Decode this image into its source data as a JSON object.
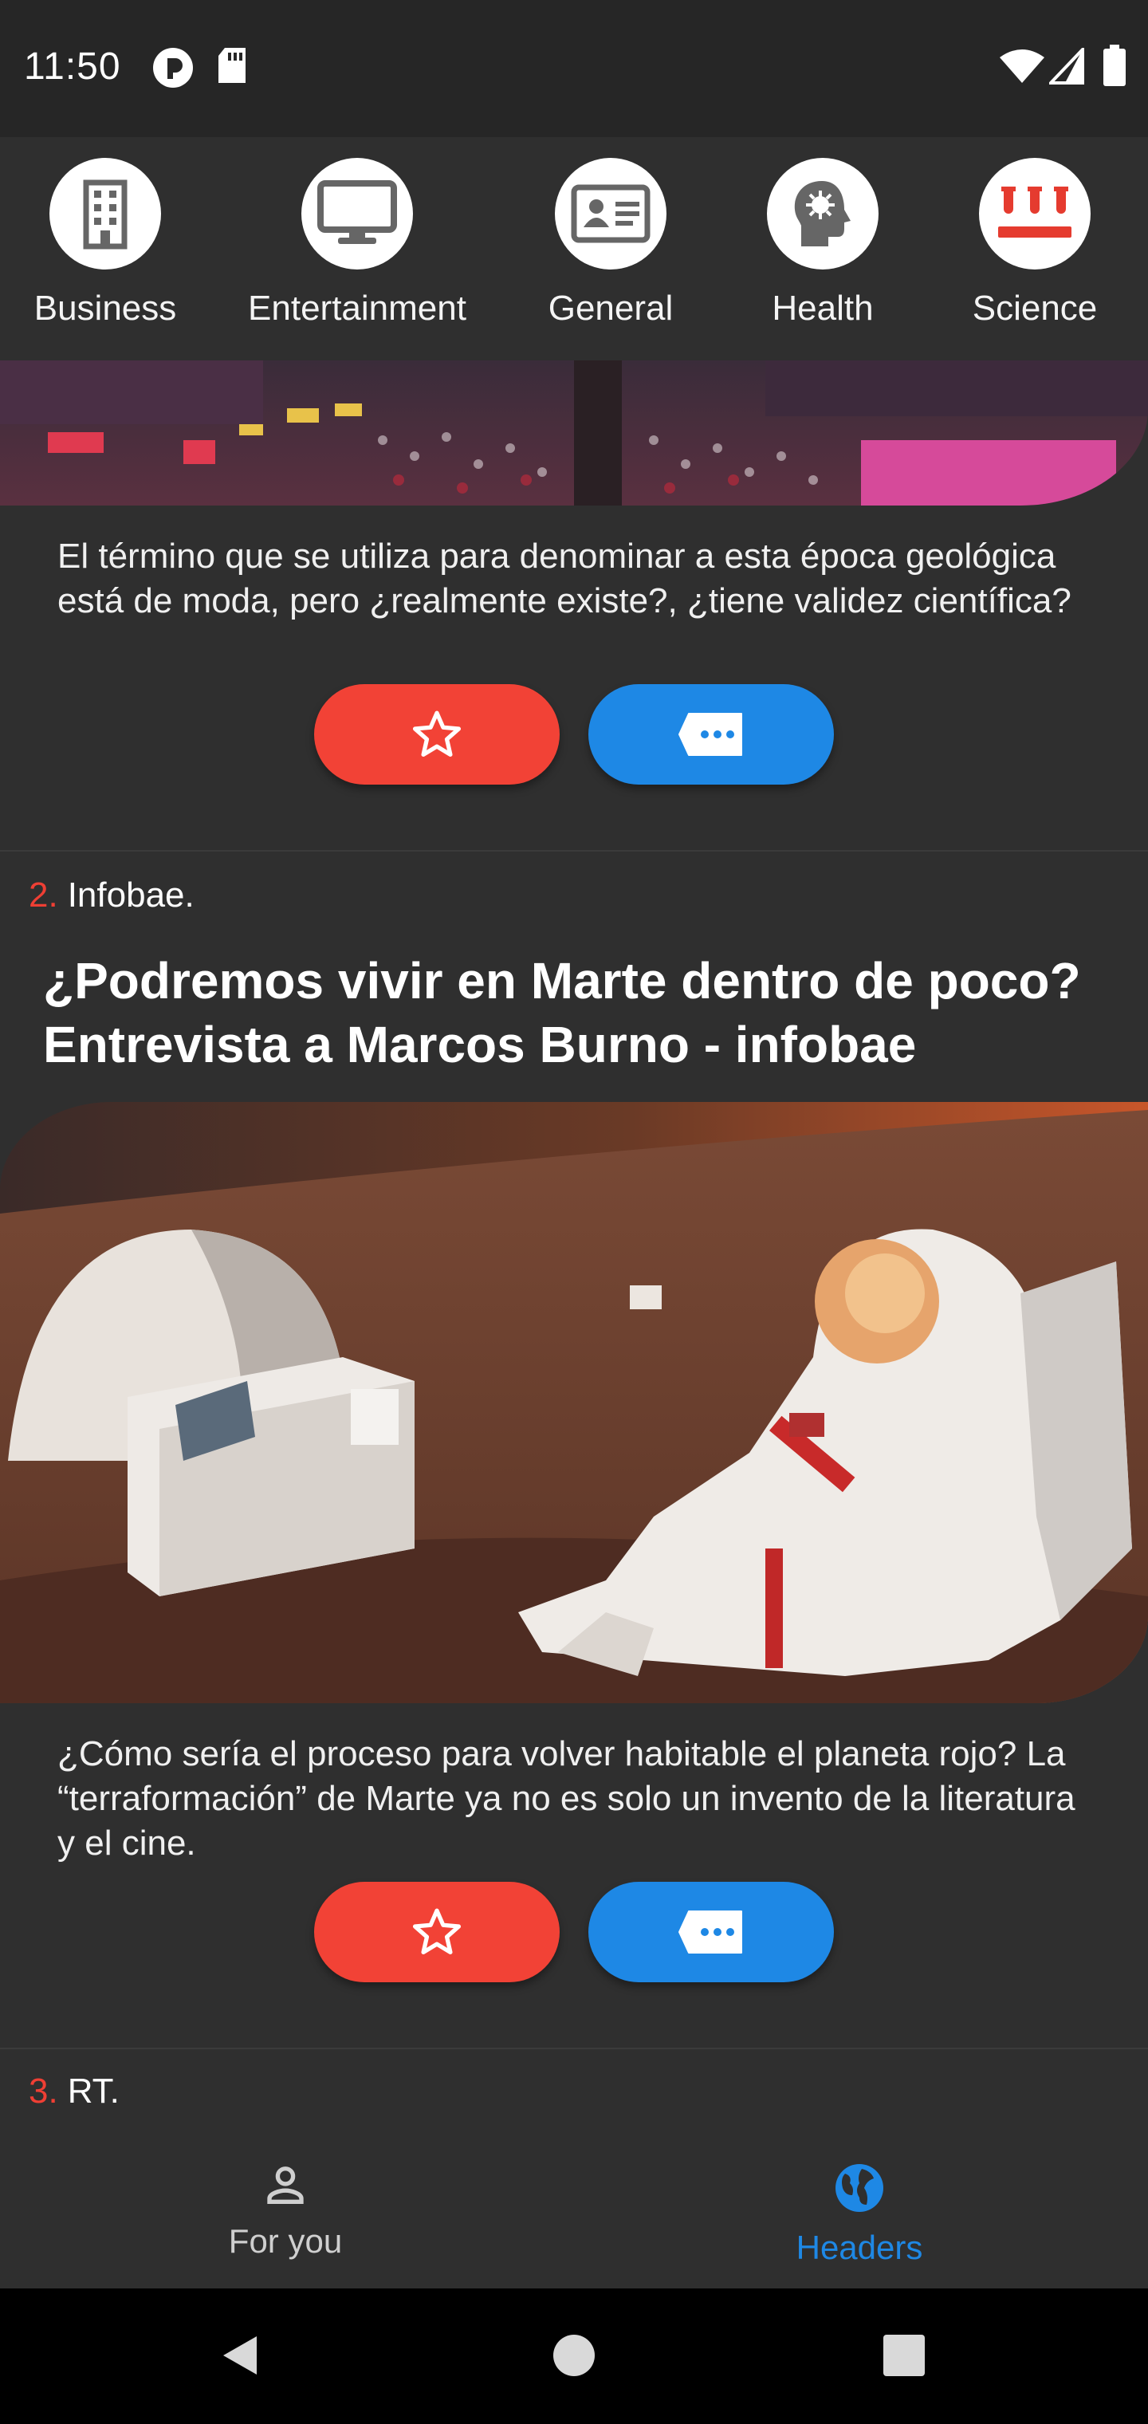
{
  "status_bar": {
    "time": "11:50",
    "icons": [
      "app-notification-icon",
      "sd-card-icon",
      "wifi-icon",
      "signal-icon",
      "battery-icon"
    ]
  },
  "categories": [
    {
      "label": "Business",
      "icon": "building-icon"
    },
    {
      "label": "Entertainment",
      "icon": "monitor-icon"
    },
    {
      "label": "General",
      "icon": "id-card-icon"
    },
    {
      "label": "Health",
      "icon": "head-virus-icon"
    },
    {
      "label": "Science",
      "icon": "test-tubes-icon"
    }
  ],
  "articles": [
    {
      "description": "El término que se utiliza para denominar a esta época geológica está de moda, pero ¿realmente existe?, ¿tiene validez científica?",
      "image": "city-crowd-photo"
    },
    {
      "number": "2.",
      "source": "Infobae.",
      "title": "¿Podremos vivir en Marte dentro de poco? Entrevista a Marcos Burno - infobae",
      "image": "astronaut-mars-photo",
      "description": "¿Cómo sería el proceso para volver habitable el planeta rojo? La “terraformación” de Marte ya no es solo un invento de la literatura y el cine."
    },
    {
      "number": "3.",
      "source": "RT."
    }
  ],
  "bottom_nav": {
    "items": [
      {
        "label": "For you",
        "icon": "person-icon",
        "active": false
      },
      {
        "label": "Headers",
        "icon": "globe-icon",
        "active": true
      }
    ]
  },
  "colors": {
    "background": "#2f2f2f",
    "favorite": "#f24236",
    "comment": "#1e88e5",
    "accent": "#1e88e5",
    "number": "#ef3f34"
  }
}
